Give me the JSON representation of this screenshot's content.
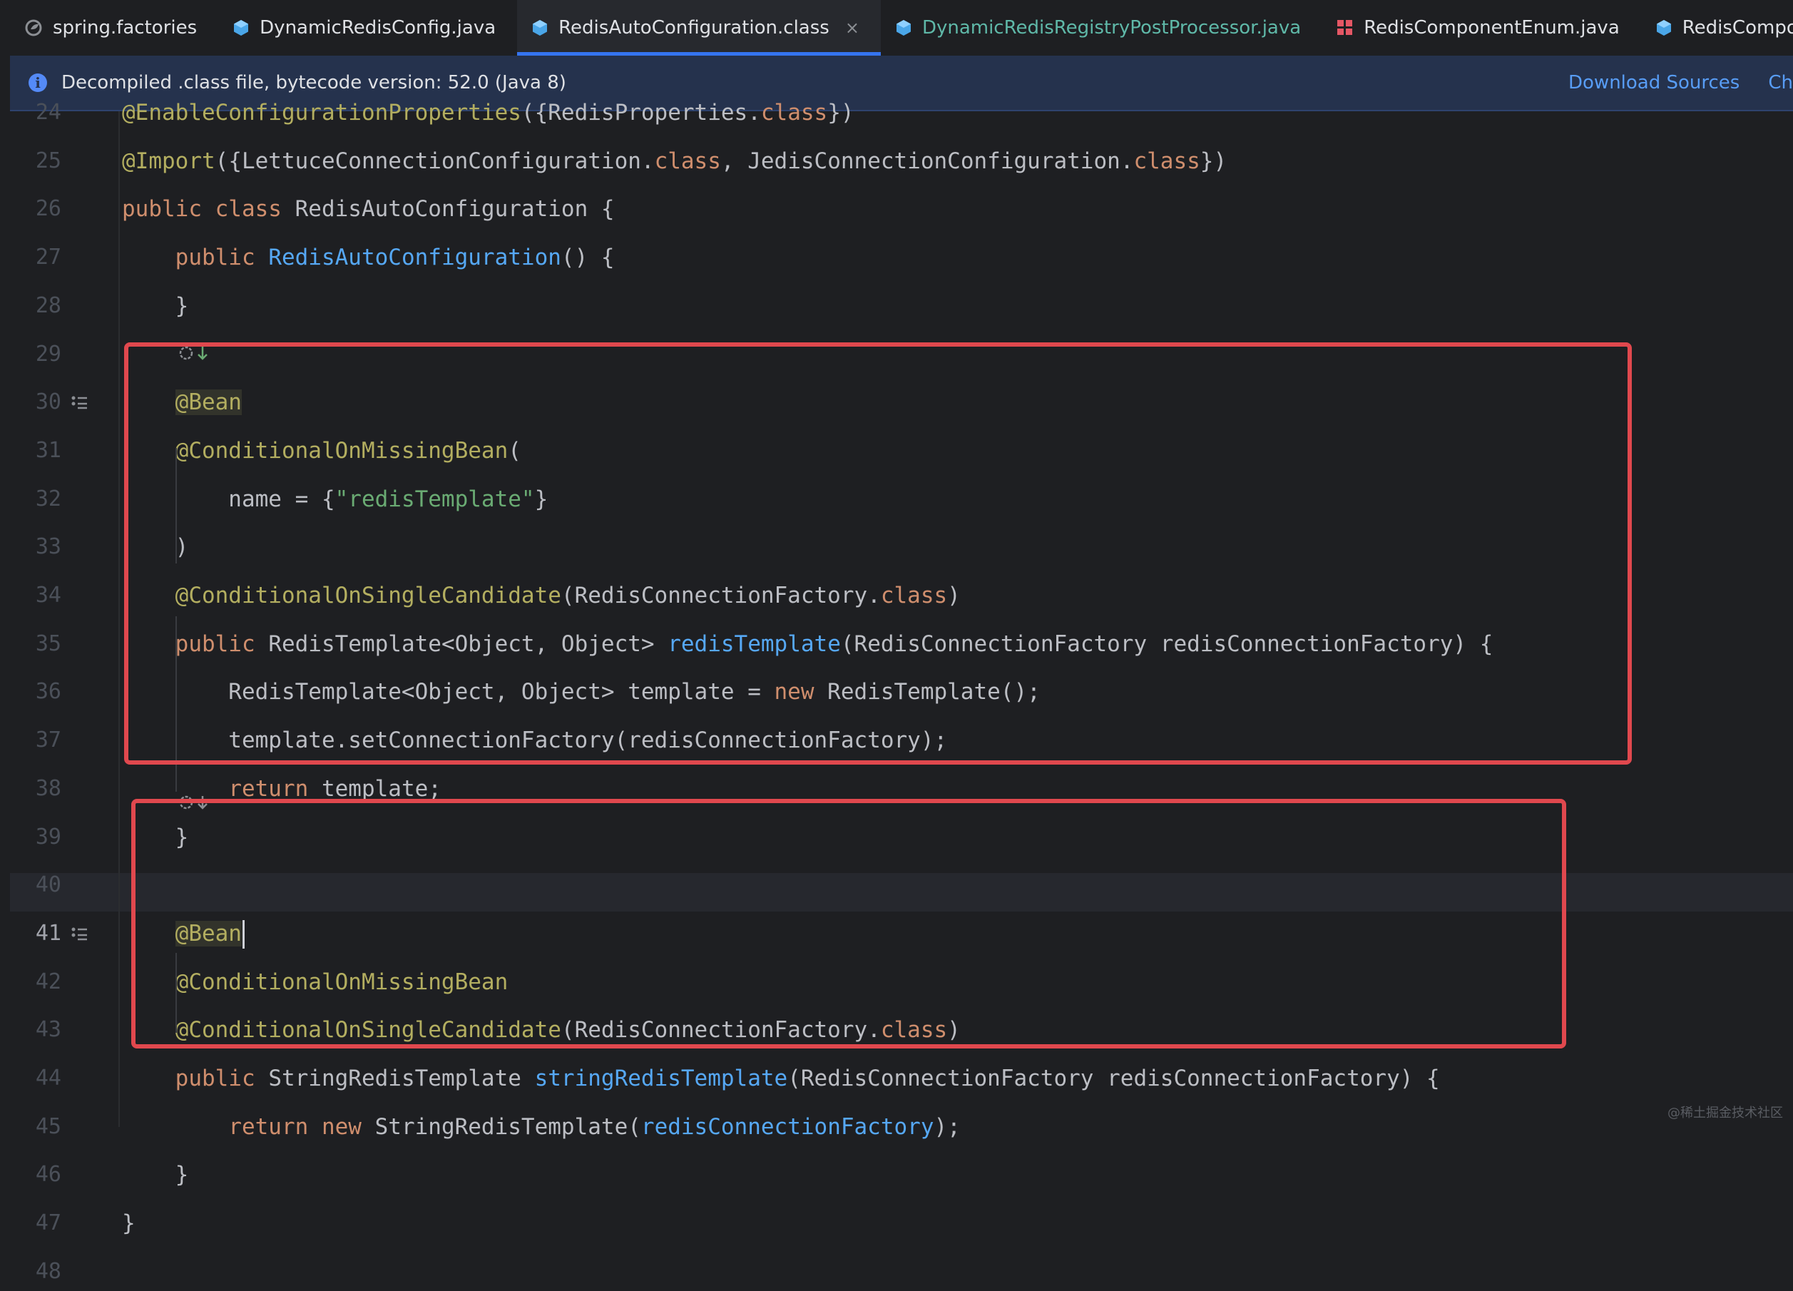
{
  "tabs": [
    {
      "label": "spring.factories",
      "icon": "spring-leaf-icon",
      "active": false,
      "color": "#dfe1e5"
    },
    {
      "label": "DynamicRedisConfig.java",
      "icon": "java-class-icon",
      "active": false,
      "color": "#dfe1e5"
    },
    {
      "label": "RedisAutoConfiguration.class",
      "icon": "java-class-icon",
      "active": true,
      "color": "#dfe1e5",
      "close": "×"
    },
    {
      "label": "DynamicRedisRegistryPostProcessor.java",
      "icon": "java-class-icon",
      "active": false,
      "color": "#5fb8a8"
    },
    {
      "label": "RedisComponentEnum.java",
      "icon": "enum-icon",
      "active": false,
      "color": "#dfe1e5"
    },
    {
      "label": "RedisCompon",
      "icon": "java-class-icon",
      "active": false,
      "color": "#dfe1e5"
    }
  ],
  "banner": {
    "info_icon_glyph": "i",
    "message": "Decompiled .class file, bytecode version: 52.0 (Java 8)",
    "download_sources": "Download Sources",
    "choose_sources": "Ch"
  },
  "editor": {
    "current_line": 41,
    "lines": [
      {
        "n": "24",
        "tokens": [
          [
            "an",
            "@EnableConfigurationProperties"
          ],
          [
            "",
            "({RedisProperties."
          ],
          [
            "kw",
            "class"
          ],
          [
            "",
            "})"
          ]
        ]
      },
      {
        "n": "25",
        "tokens": [
          [
            "an",
            "@Import"
          ],
          [
            "",
            "({LettuceConnectionConfiguration."
          ],
          [
            "kw",
            "class"
          ],
          [
            "",
            ", JedisConnectionConfiguration."
          ],
          [
            "kw",
            "class"
          ],
          [
            "",
            "})"
          ]
        ]
      },
      {
        "n": "26",
        "tokens": [
          [
            "kw",
            "public class "
          ],
          [
            "",
            "RedisAutoConfiguration {"
          ]
        ]
      },
      {
        "n": "27",
        "tokens": [
          [
            "",
            "    "
          ],
          [
            "kw",
            "public "
          ],
          [
            "fn",
            "RedisAutoConfiguration"
          ],
          [
            "",
            "() {"
          ]
        ]
      },
      {
        "n": "28",
        "tokens": [
          [
            "",
            "    }"
          ]
        ]
      },
      {
        "n": "29",
        "tokens": []
      },
      {
        "n": "30",
        "tokens": [
          [
            "",
            "    "
          ],
          [
            "an hl-bean",
            "@Bean"
          ]
        ],
        "bookmark": true
      },
      {
        "n": "31",
        "tokens": [
          [
            "",
            "    "
          ],
          [
            "an",
            "@ConditionalOnMissingBean"
          ],
          [
            "",
            "("
          ]
        ]
      },
      {
        "n": "32",
        "tokens": [
          [
            "",
            "        name = {"
          ],
          [
            "st",
            "\"redisTemplate\""
          ],
          [
            "",
            "}"
          ]
        ]
      },
      {
        "n": "33",
        "tokens": [
          [
            "",
            "    )"
          ]
        ]
      },
      {
        "n": "34",
        "tokens": [
          [
            "",
            "    "
          ],
          [
            "an",
            "@ConditionalOnSingleCandidate"
          ],
          [
            "",
            "(RedisConnectionFactory."
          ],
          [
            "kw",
            "class"
          ],
          [
            "",
            ")"
          ]
        ]
      },
      {
        "n": "35",
        "tokens": [
          [
            "",
            "    "
          ],
          [
            "kw",
            "public "
          ],
          [
            "",
            "RedisTemplate<Object, Object> "
          ],
          [
            "fn",
            "redisTemplate"
          ],
          [
            "",
            "(RedisConnectionFactory redisConnectionFactory) {"
          ]
        ]
      },
      {
        "n": "36",
        "tokens": [
          [
            "",
            "        RedisTemplate<Object, Object> template = "
          ],
          [
            "kw",
            "new "
          ],
          [
            "",
            "RedisTemplate();"
          ]
        ]
      },
      {
        "n": "37",
        "tokens": [
          [
            "",
            "        template.setConnectionFactory(redisConnectionFactory);"
          ]
        ]
      },
      {
        "n": "38",
        "tokens": [
          [
            "",
            "        "
          ],
          [
            "kw",
            "return "
          ],
          [
            "",
            "template;"
          ]
        ]
      },
      {
        "n": "39",
        "tokens": [
          [
            "",
            "    }"
          ]
        ]
      },
      {
        "n": "40",
        "tokens": []
      },
      {
        "n": "41",
        "tokens": [
          [
            "",
            "    "
          ],
          [
            "an hl-bean",
            "@Bean"
          ],
          [
            "caret",
            ""
          ]
        ],
        "bookmark": true
      },
      {
        "n": "42",
        "tokens": [
          [
            "",
            "    "
          ],
          [
            "an",
            "@ConditionalOnMissingBean"
          ]
        ]
      },
      {
        "n": "43",
        "tokens": [
          [
            "",
            "    "
          ],
          [
            "an",
            "@ConditionalOnSingleCandidate"
          ],
          [
            "",
            "(RedisConnectionFactory."
          ],
          [
            "kw",
            "class"
          ],
          [
            "",
            ")"
          ]
        ]
      },
      {
        "n": "44",
        "tokens": [
          [
            "",
            "    "
          ],
          [
            "kw",
            "public "
          ],
          [
            "",
            "StringRedisTemplate "
          ],
          [
            "fn",
            "stringRedisTemplate"
          ],
          [
            "",
            "(RedisConnectionFactory redisConnectionFactory) {"
          ]
        ]
      },
      {
        "n": "45",
        "tokens": [
          [
            "",
            "        "
          ],
          [
            "kw",
            "return new "
          ],
          [
            "",
            "StringRedisTemplate("
          ],
          [
            "fn",
            "redisConnectionFactory"
          ],
          [
            "",
            ");"
          ]
        ]
      },
      {
        "n": "46",
        "tokens": [
          [
            "",
            "    }"
          ]
        ]
      },
      {
        "n": "47",
        "tokens": [
          [
            "",
            "}"
          ]
        ]
      },
      {
        "n": "48",
        "tokens": []
      }
    ]
  },
  "watermark": "@稀土掘金技术社区",
  "colors": {
    "highlight_box": "#e0484e",
    "keyword": "#cf8e6d",
    "annotation": "#b3ae60",
    "method": "#56a8f5",
    "string": "#6aab73",
    "accent": "#3574f0"
  }
}
